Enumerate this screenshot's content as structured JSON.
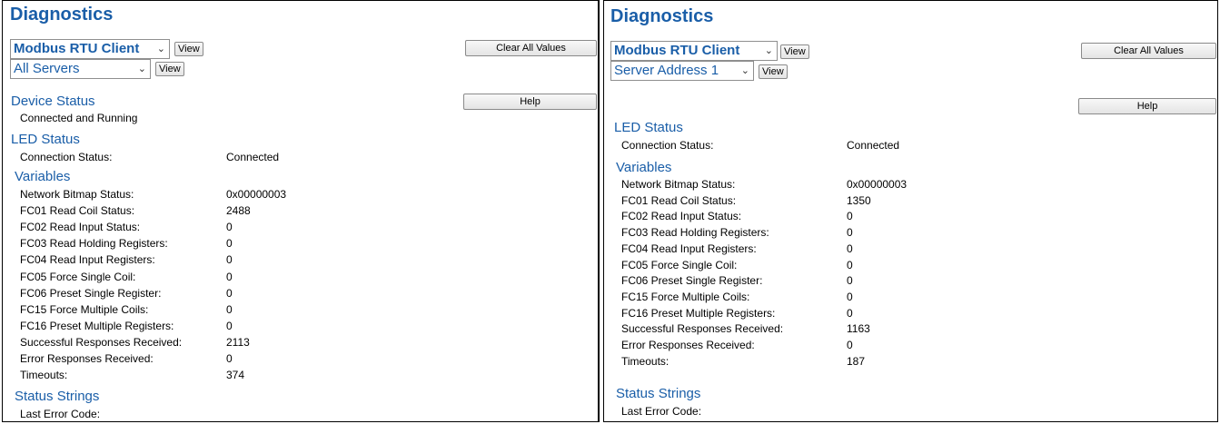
{
  "left": {
    "title": "Diagnostics",
    "protocol_select": "Modbus RTU Client",
    "server_select": "All Servers",
    "view_label": "View",
    "clear_label": "Clear All Values",
    "help_label": "Help",
    "device_status": {
      "heading": "Device Status",
      "text": "Connected and Running"
    },
    "led_status": {
      "heading": "LED Status",
      "rows": [
        {
          "label": "Connection Status:",
          "value": "Connected"
        }
      ]
    },
    "variables": {
      "heading": "Variables",
      "rows": [
        {
          "label": "Network Bitmap Status:",
          "value": "0x00000003"
        },
        {
          "label": "FC01 Read Coil Status:",
          "value": "2488"
        },
        {
          "label": "FC02 Read Input Status:",
          "value": "0"
        },
        {
          "label": "FC03 Read Holding Registers:",
          "value": "0"
        },
        {
          "label": "FC04 Read Input Registers:",
          "value": "0"
        },
        {
          "label": "FC05 Force Single Coil:",
          "value": "0"
        },
        {
          "label": "FC06 Preset Single Register:",
          "value": "0"
        },
        {
          "label": "FC15 Force Multiple Coils:",
          "value": "0"
        },
        {
          "label": "FC16 Preset Multiple Registers:",
          "value": "0"
        },
        {
          "label": "Successful Responses Received:",
          "value": "2113"
        },
        {
          "label": "Error Responses Received:",
          "value": "0"
        },
        {
          "label": "Timeouts:",
          "value": "374"
        }
      ]
    },
    "status_strings": {
      "heading": "Status Strings",
      "rows": [
        {
          "label": "Last Error Code:",
          "value": ""
        }
      ]
    }
  },
  "right": {
    "title": "Diagnostics",
    "protocol_select": "Modbus RTU Client",
    "server_select": "Server Address 1",
    "view_label": "View",
    "clear_label": "Clear All Values",
    "help_label": "Help",
    "led_status": {
      "heading": "LED Status",
      "rows": [
        {
          "label": "Connection Status:",
          "value": "Connected"
        }
      ]
    },
    "variables": {
      "heading": "Variables",
      "rows": [
        {
          "label": "Network Bitmap Status:",
          "value": "0x00000003"
        },
        {
          "label": "FC01 Read Coil Status:",
          "value": "1350"
        },
        {
          "label": "FC02 Read Input Status:",
          "value": "0"
        },
        {
          "label": "FC03 Read Holding Registers:",
          "value": "0"
        },
        {
          "label": "FC04 Read Input Registers:",
          "value": "0"
        },
        {
          "label": "FC05 Force Single Coil:",
          "value": "0"
        },
        {
          "label": "FC06 Preset Single Register:",
          "value": "0"
        },
        {
          "label": "FC15 Force Multiple Coils:",
          "value": "0"
        },
        {
          "label": "FC16 Preset Multiple Registers:",
          "value": "0"
        },
        {
          "label": "Successful Responses Received:",
          "value": "1163"
        },
        {
          "label": "Error Responses Received:",
          "value": "0"
        },
        {
          "label": "Timeouts:",
          "value": "187"
        }
      ]
    },
    "status_strings": {
      "heading": "Status Strings",
      "rows": [
        {
          "label": "Last Error Code:",
          "value": ""
        }
      ]
    }
  },
  "colors": {
    "accent": "#1a5ea8"
  },
  "icons": {
    "select_arrow": "chevron-down-icon"
  }
}
